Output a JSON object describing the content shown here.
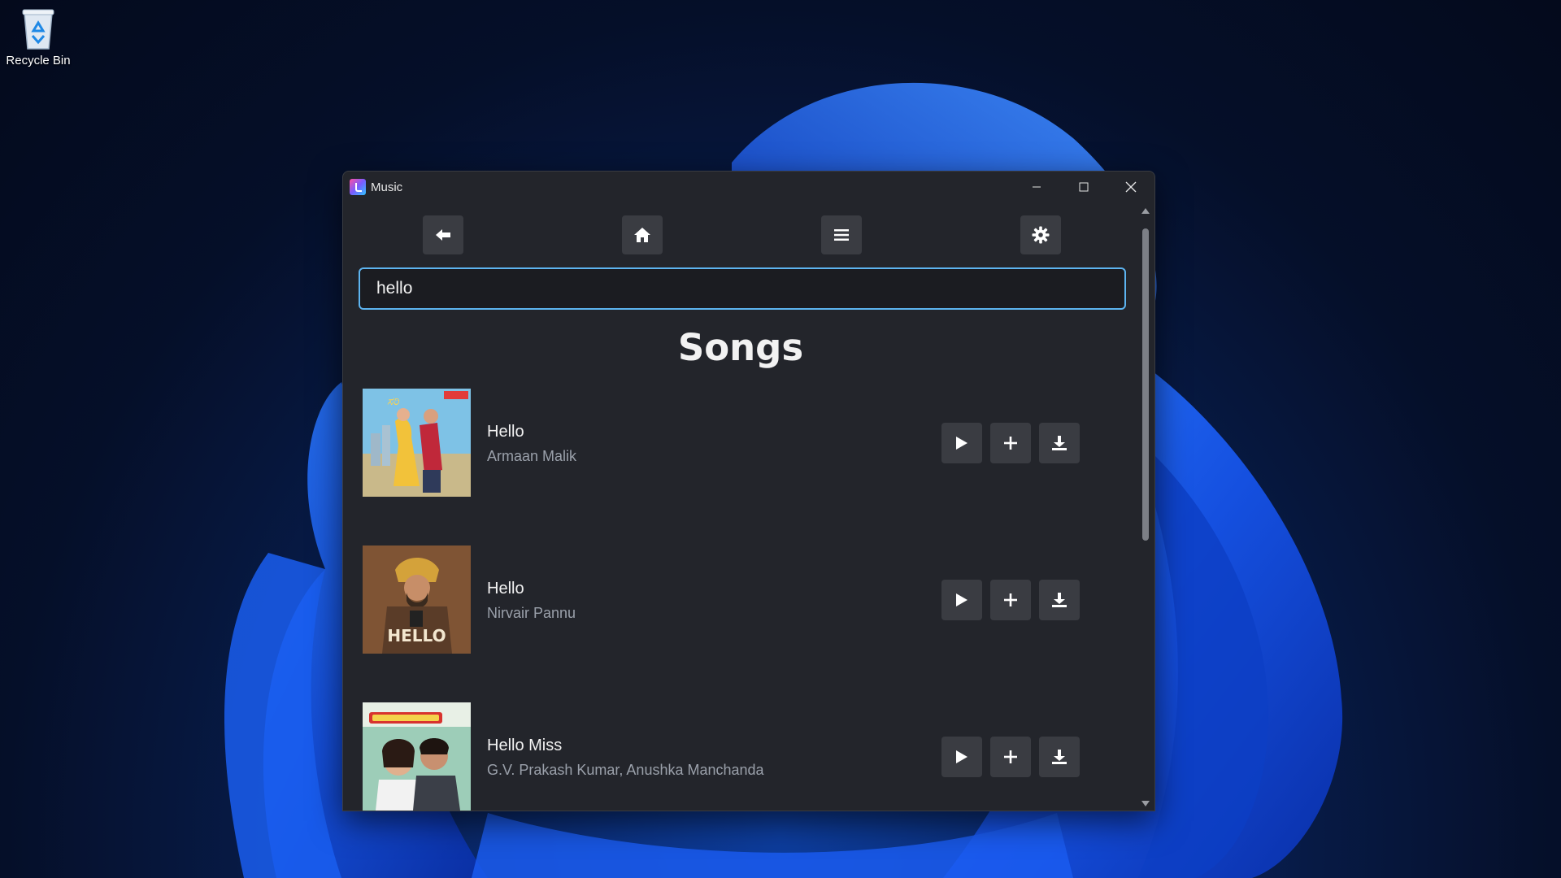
{
  "desktop": {
    "recycle_bin_label": "Recycle Bin"
  },
  "window": {
    "title": "Music"
  },
  "toolbar": {
    "back_icon": "back-arrow-icon",
    "home_icon": "home-icon",
    "menu_icon": "hamburger-menu-icon",
    "settings_icon": "gear-icon"
  },
  "search": {
    "value": "hello"
  },
  "section": {
    "title": "Songs"
  },
  "songs": [
    {
      "title": "Hello",
      "artist": "Armaan Malik"
    },
    {
      "title": "Hello",
      "artist": "Nirvair Pannu"
    },
    {
      "title": "Hello Miss",
      "artist": "G.V. Prakash Kumar, Anushka Manchanda"
    }
  ],
  "colors": {
    "accent": "#5db4f0",
    "window_bg": "#23252b",
    "button_bg": "#3a3c42"
  }
}
